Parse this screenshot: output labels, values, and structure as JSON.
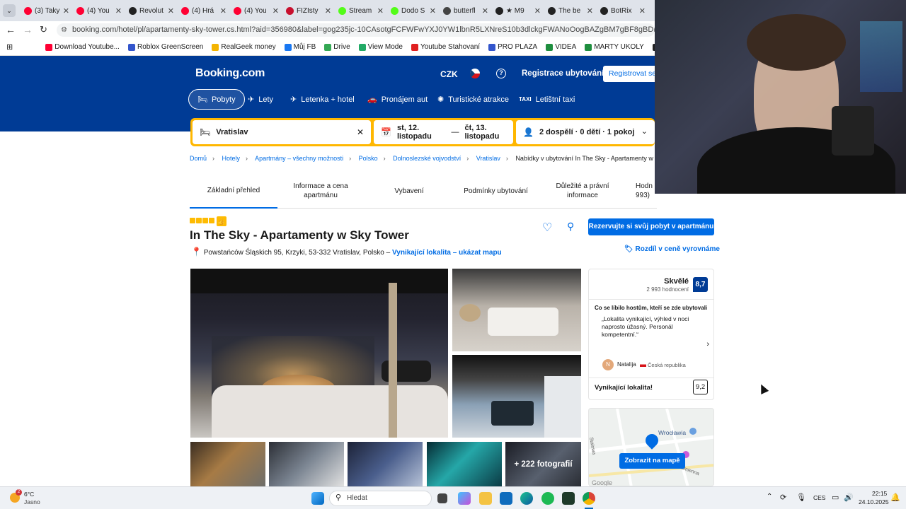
{
  "browser": {
    "tabs": [
      {
        "title": "(3) Taky",
        "color": "#ff0033"
      },
      {
        "title": "(4) You",
        "color": "#ff0033"
      },
      {
        "title": "Revolut",
        "color": "#222222"
      },
      {
        "title": "(4) Hrá",
        "color": "#ff0033"
      },
      {
        "title": "(4) You",
        "color": "#ff0033"
      },
      {
        "title": "FIZIsty",
        "color": "#c8102e"
      },
      {
        "title": "Stream",
        "color": "#53fc18"
      },
      {
        "title": "Dodo S",
        "color": "#53fc18"
      },
      {
        "title": "butterfl",
        "color": "#444444"
      },
      {
        "title": "★ M9",
        "color": "#222222"
      },
      {
        "title": "The be",
        "color": "#222222"
      },
      {
        "title": "BotRix",
        "color": "#222222"
      }
    ],
    "url": "booking.com/hotel/pl/apartamenty-sky-tower.cs.html?aid=356980&label=gog235jc-10CAsotgFCFWFwYXJ0YW1lbnR5LXNreS10b3dlckgFWANoOogBAZgBM7gBF8gBDNgBA-gBAfgBAYgCAagCAbgC...",
    "bookmarks": [
      {
        "label": "Download Youtube...",
        "color": "#ff0033"
      },
      {
        "label": "Roblox GreenScreen",
        "color": "#3355cc"
      },
      {
        "label": "RealGeek money",
        "color": "#f4b400"
      },
      {
        "label": "Můj FB",
        "color": "#1877f2"
      },
      {
        "label": "Drive",
        "color": "#34a853"
      },
      {
        "label": "View Mode",
        "color": "#22aa66"
      },
      {
        "label": "Youtube Stahovaní",
        "color": "#e02020"
      },
      {
        "label": "PRO PLAZA",
        "color": "#3355cc"
      },
      {
        "label": "VIDEA",
        "color": "#1e8e3e"
      },
      {
        "label": "MARTY UKOLY",
        "color": "#1e8e3e"
      },
      {
        "label": "Dodo video",
        "color": "#222222"
      }
    ]
  },
  "header": {
    "logo": "Booking.com",
    "currency": "CZK",
    "help_icon": "question-icon",
    "list_property": "Registrace ubytování",
    "register": "Registrovat se",
    "nav": [
      "Pobyty",
      "Lety",
      "Letenka + hotel",
      "Pronájem aut",
      "Turistické atrakce",
      "Letištní taxi"
    ]
  },
  "search": {
    "destination": "Vratislav",
    "dates_from": "st, 12. listopadu",
    "dates_sep": "—",
    "dates_to": "čt, 13. listopadu",
    "guests": "2 dospělí · 0 dětí · 1 pokoj"
  },
  "breadcrumb": [
    "Domů",
    "Hotely",
    "Apartmány – všechny možnosti",
    "Polsko",
    "Dolnoslezské vojvodství",
    "Vratislav",
    "Nabídky v ubytování In The Sky - Apartamenty w Sky Tower (Apartm"
  ],
  "page_tabs": [
    [
      "Základní přehled"
    ],
    [
      "Informace a cena",
      "apartmánu"
    ],
    [
      "Vybavení"
    ],
    [
      "Podmínky ubytování"
    ],
    [
      "Důležité a právní",
      "informace"
    ],
    [
      "Hodn",
      "993)"
    ]
  ],
  "property": {
    "stars": 4,
    "name": "In The Sky - Apartamenty w Sky Tower",
    "address": "Powstańców Śląskich 95, Krzyki, 53-332 Vratislav, Polsko –",
    "location_link": "Vynikající lokalita – ukázat mapu",
    "reserve_button": "Rezervujte si svůj pobyt v apartmánu",
    "price_match": "Rozdíl v ceně vyrovnáme",
    "more_photos": "+ 222 fotografií"
  },
  "review": {
    "label": "Skvělé",
    "count": "2 993 hodnocení",
    "score": "8,7",
    "liked_heading": "Co se líbilo hostům, kteří se zde ubytovali",
    "quote": "„Lokalita vynikající, výhled v noci naprosto úžasný. Personál kompetentní.“",
    "reviewer_initial": "N",
    "reviewer": "Natalija",
    "country": "Česká republika",
    "location_label": "Vynikající lokalita!",
    "location_score": "9,2"
  },
  "map": {
    "button": "Zobrazit na mapě",
    "city": "Wrocławia",
    "street1": "Stalowa",
    "street2": "Kamienna",
    "brand": "Google"
  },
  "taskbar": {
    "weather_temp": "6°C",
    "weather_desc": "Jasno",
    "weather_badge": "2",
    "search_placeholder": "Hledat",
    "lang": "CES",
    "time": "22:15",
    "date": "24.10.2025"
  }
}
